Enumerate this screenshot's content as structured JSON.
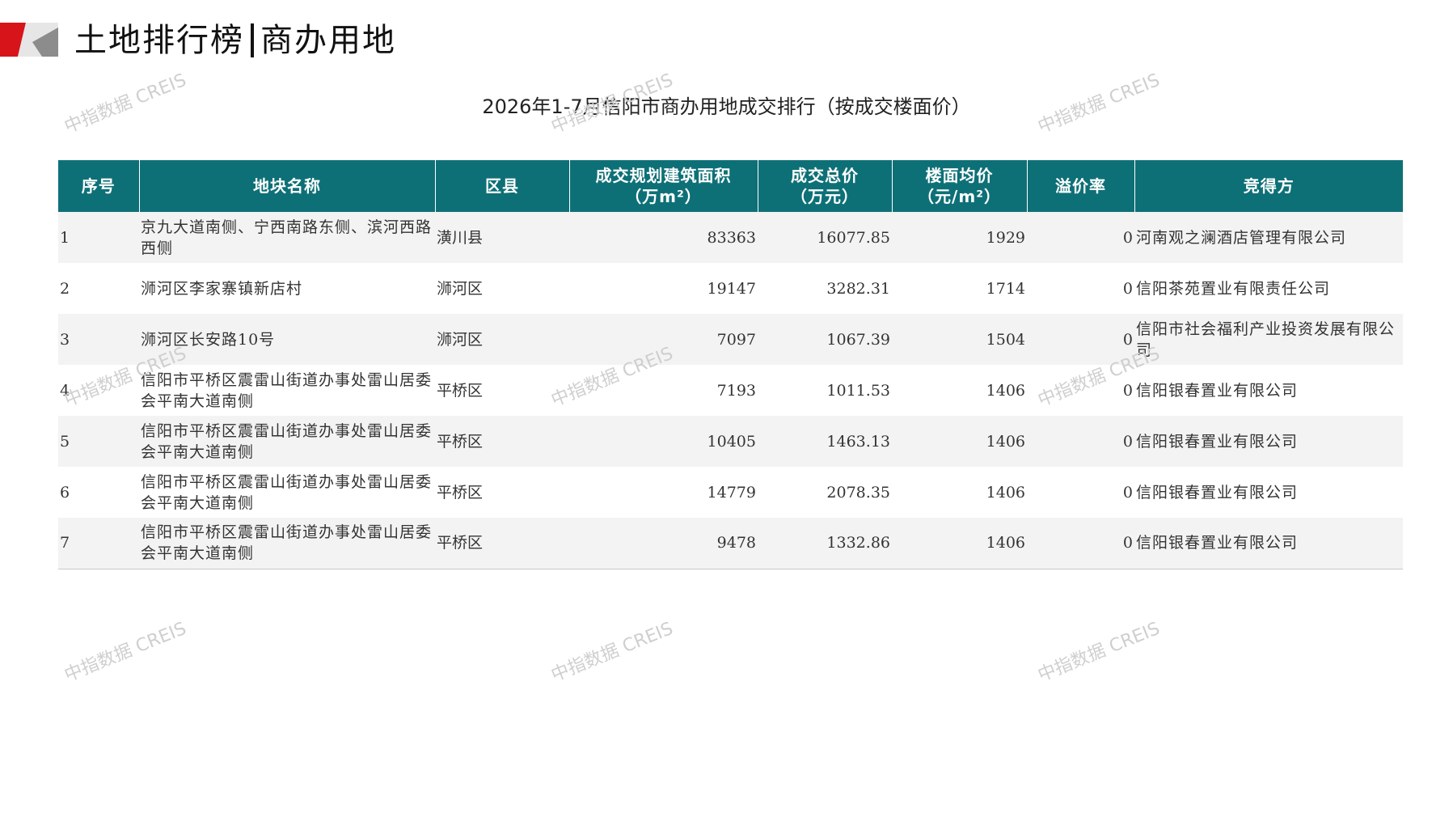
{
  "header": {
    "title_left": "土地排行榜",
    "title_right": "商办用地"
  },
  "table_title": "2026年1-7月信阳市商办用地成交排行（按成交楼面价）",
  "watermark": "中指数据 CREIS",
  "colors": {
    "header_bg": "#0e7077",
    "price_text": "#cc1d1d",
    "logo_red": "#d7141a",
    "logo_gray": "#8c8c8c"
  },
  "columns": [
    {
      "line1": "序号",
      "line2": ""
    },
    {
      "line1": "地块名称",
      "line2": ""
    },
    {
      "line1": "区县",
      "line2": ""
    },
    {
      "line1": "成交规划建筑面积",
      "line2": "（万m²）"
    },
    {
      "line1": "成交总价",
      "line2": "（万元）"
    },
    {
      "line1": "楼面均价",
      "line2": "（元/m²）"
    },
    {
      "line1": "溢价率",
      "line2": ""
    },
    {
      "line1": "竞得方",
      "line2": ""
    }
  ],
  "rows": [
    {
      "idx": "1",
      "name": "京九大道南侧、宁西南路东侧、滨河西路西侧",
      "district": "潢川县",
      "area": "83363",
      "total": "16077.85",
      "price": "1929",
      "rate": "0",
      "winner": "河南观之澜酒店管理有限公司"
    },
    {
      "idx": "2",
      "name": "浉河区李家寨镇新店村",
      "district": "浉河区",
      "area": "19147",
      "total": "3282.31",
      "price": "1714",
      "rate": "0",
      "winner": "信阳茶苑置业有限责任公司"
    },
    {
      "idx": "3",
      "name": "浉河区长安路10号",
      "district": "浉河区",
      "area": "7097",
      "total": "1067.39",
      "price": "1504",
      "rate": "0",
      "winner": "信阳市社会福利产业投资发展有限公司"
    },
    {
      "idx": "4",
      "name": "信阳市平桥区震雷山街道办事处雷山居委会平南大道南侧",
      "district": "平桥区",
      "area": "7193",
      "total": "1011.53",
      "price": "1406",
      "rate": "0",
      "winner": "信阳银春置业有限公司"
    },
    {
      "idx": "5",
      "name": "信阳市平桥区震雷山街道办事处雷山居委会平南大道南侧",
      "district": "平桥区",
      "area": "10405",
      "total": "1463.13",
      "price": "1406",
      "rate": "0",
      "winner": "信阳银春置业有限公司"
    },
    {
      "idx": "6",
      "name": "信阳市平桥区震雷山街道办事处雷山居委会平南大道南侧",
      "district": "平桥区",
      "area": "14779",
      "total": "2078.35",
      "price": "1406",
      "rate": "0",
      "winner": "信阳银春置业有限公司"
    },
    {
      "idx": "7",
      "name": "信阳市平桥区震雷山街道办事处雷山居委会平南大道南侧",
      "district": "平桥区",
      "area": "9478",
      "total": "1332.86",
      "price": "1406",
      "rate": "0",
      "winner": "信阳银春置业有限公司"
    }
  ]
}
